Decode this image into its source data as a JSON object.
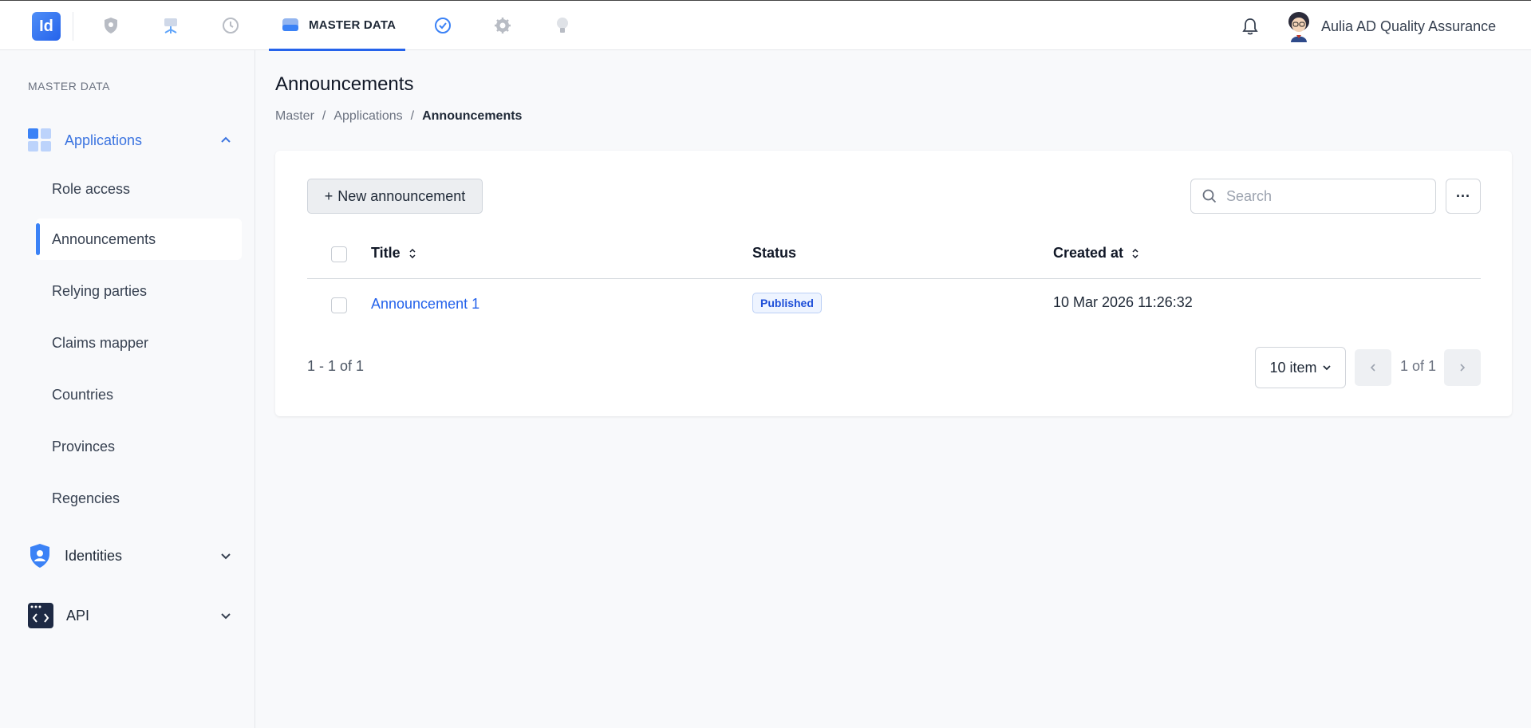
{
  "topbar": {
    "logo_text": "Id",
    "active_nav_label": "MASTER DATA",
    "nav_icons": [
      "shield-icon",
      "sitemap-icon",
      "history-icon",
      "master-data-icon",
      "verified-badge-icon",
      "settings-icon",
      "lightbulb-icon"
    ],
    "user_name": "Aulia AD Quality Assurance"
  },
  "sidebar": {
    "heading": "MASTER DATA",
    "groups": {
      "applications": {
        "label": "Applications",
        "expanded": true
      },
      "identities": {
        "label": "Identities",
        "expanded": false
      },
      "api": {
        "label": "API",
        "expanded": false
      }
    },
    "items": [
      "Role access",
      "Announcements",
      "Relying parties",
      "Claims mapper",
      "Countries",
      "Provinces",
      "Regencies"
    ],
    "active_item": "Announcements"
  },
  "main": {
    "title": "Announcements",
    "breadcrumb": [
      "Master",
      "Applications",
      "Announcements"
    ],
    "new_button_label": "New announcement",
    "search_placeholder": "Search",
    "columns": [
      "Title",
      "Status",
      "Created at"
    ],
    "rows": [
      {
        "title": "Announcement 1",
        "status": "Published",
        "created_at": "10 Mar 2026 11:26:32"
      }
    ],
    "count_text": "1 - 1 of 1",
    "per_page": "10 item",
    "page_info": "1 of 1"
  },
  "colors": {
    "accent": "#2563eb",
    "active_indicator": "#3b82f6",
    "badge_bg": "#eef4ff"
  }
}
